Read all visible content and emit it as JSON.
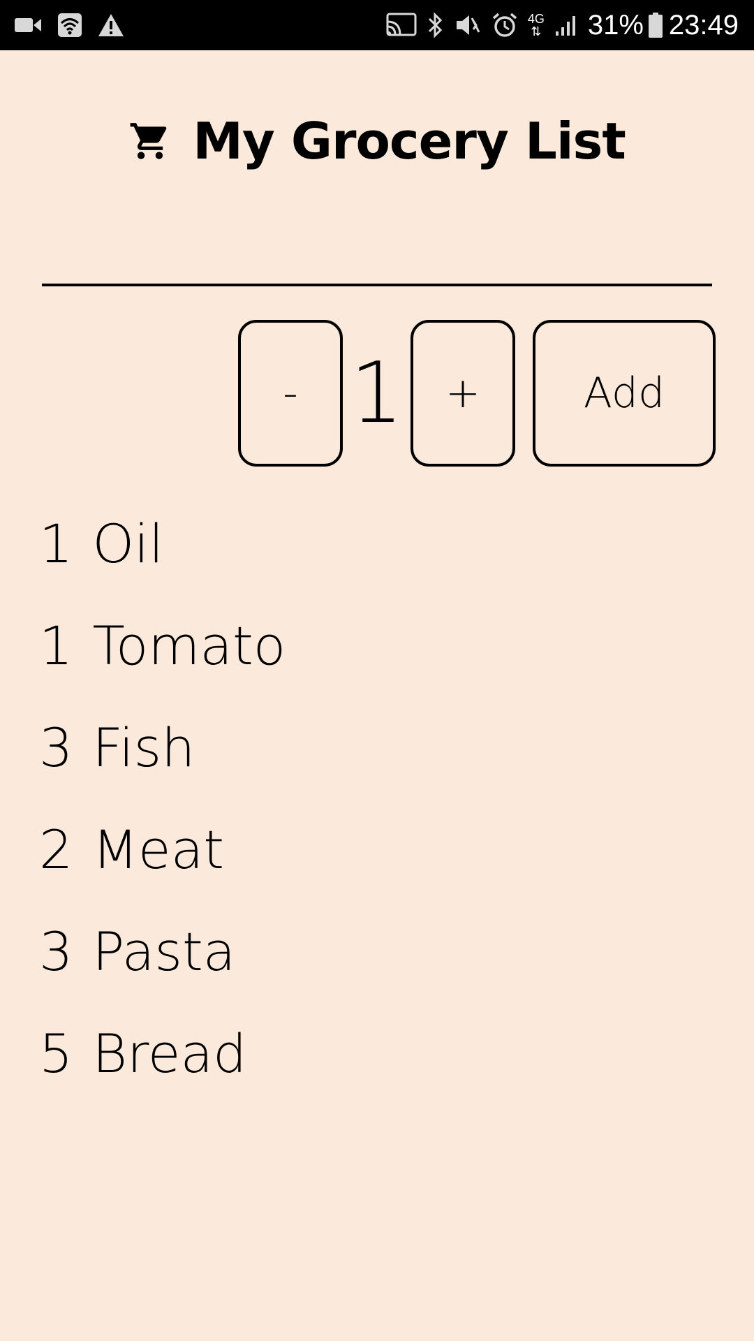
{
  "status_bar": {
    "left_icons": [
      "video-camera-icon",
      "wifi-icon",
      "warning-icon"
    ],
    "right_icons": [
      "cast-icon",
      "bluetooth-icon",
      "mute-vibrate-icon",
      "alarm-icon"
    ],
    "network_type": "4G",
    "battery": "31%",
    "time": "23:49"
  },
  "header": {
    "icon": "shopping-cart-icon",
    "title": "My Grocery List"
  },
  "input": {
    "value": "",
    "placeholder": ""
  },
  "controls": {
    "decrement_label": "-",
    "quantity": "1",
    "increment_label": "+",
    "add_label": "Add"
  },
  "items": [
    {
      "qty": "1",
      "name": "Oil"
    },
    {
      "qty": "1",
      "name": "Tomato"
    },
    {
      "qty": "3",
      "name": "Fish"
    },
    {
      "qty": "2",
      "name": "Meat"
    },
    {
      "qty": "3",
      "name": "Pasta"
    },
    {
      "qty": "5",
      "name": "Bread"
    }
  ],
  "colors": {
    "background": "#FBE9DB",
    "text": "#000000",
    "status_bar": "#000000"
  }
}
